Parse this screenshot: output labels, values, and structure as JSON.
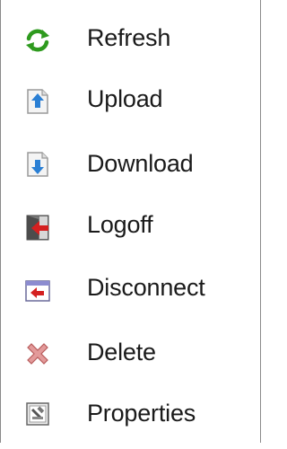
{
  "menu": {
    "items": [
      {
        "label": "Refresh",
        "icon": "refresh-icon"
      },
      {
        "label": "Upload",
        "icon": "upload-icon"
      },
      {
        "label": "Download",
        "icon": "download-icon"
      },
      {
        "label": "Logoff",
        "icon": "logoff-icon"
      },
      {
        "label": "Disconnect",
        "icon": "disconnect-icon"
      },
      {
        "label": "Delete",
        "icon": "delete-icon"
      },
      {
        "label": "Properties",
        "icon": "properties-icon"
      }
    ]
  },
  "colors": {
    "refresh_green": "#2e9a1e",
    "arrow_blue": "#2a7fd4",
    "arrow_red": "#d42020",
    "delete_red": "#d98080",
    "border_gray": "#8a8a8a"
  }
}
